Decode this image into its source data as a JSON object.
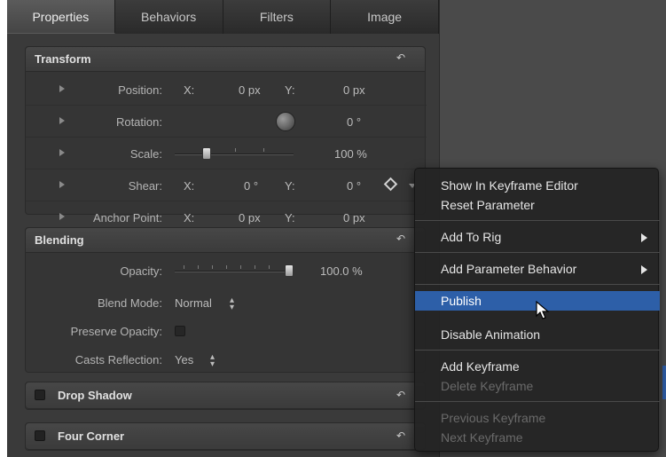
{
  "tabs": [
    {
      "label": "Properties",
      "active": true
    },
    {
      "label": "Behaviors",
      "active": false
    },
    {
      "label": "Filters",
      "active": false
    },
    {
      "label": "Image",
      "active": false
    }
  ],
  "transform": {
    "title": "Transform",
    "reset_icon": "reset-arrow-icon",
    "rows": {
      "position": {
        "label": "Position:",
        "x_label": "X:",
        "x_value": "0 px",
        "y_label": "Y:",
        "y_value": "0 px"
      },
      "rotation": {
        "label": "Rotation:",
        "value": "0 °"
      },
      "scale": {
        "label": "Scale:",
        "value": "100 %",
        "level_percent": 100
      },
      "shear": {
        "label": "Shear:",
        "x_label": "X:",
        "x_value": "0 °",
        "y_label": "Y:",
        "y_value": "0 °"
      },
      "anchor_point": {
        "label": "Anchor Point:",
        "x_label": "X:",
        "x_value": "0 px",
        "y_label": "Y:",
        "y_value": "0 px"
      }
    }
  },
  "blending": {
    "title": "Blending",
    "opacity": {
      "label": "Opacity:",
      "value": "100.0 %",
      "level_percent": 100
    },
    "blend_mode": {
      "label": "Blend Mode:",
      "value": "Normal"
    },
    "preserve_opacity": {
      "label": "Preserve Opacity:",
      "checked": false
    },
    "casts_reflection": {
      "label": "Casts Reflection:",
      "value": "Yes"
    }
  },
  "drop_shadow": {
    "title": "Drop Shadow"
  },
  "four_corner": {
    "title": "Four Corner"
  },
  "context_menu": {
    "items": {
      "show_keyframe_editor": "Show In Keyframe Editor",
      "reset_parameter": "Reset Parameter",
      "add_to_rig": "Add To Rig",
      "add_parameter_behavior": "Add Parameter Behavior",
      "publish": "Publish",
      "disable_animation": "Disable Animation",
      "add_keyframe": "Add Keyframe",
      "delete_keyframe": "Delete Keyframe",
      "previous_keyframe": "Previous Keyframe",
      "next_keyframe": "Next Keyframe"
    },
    "selected_item": "Publish"
  },
  "colors": {
    "panel_bg": "#3a3a3a",
    "menu_bg": "#242424",
    "selection": "#2d5fa8"
  }
}
